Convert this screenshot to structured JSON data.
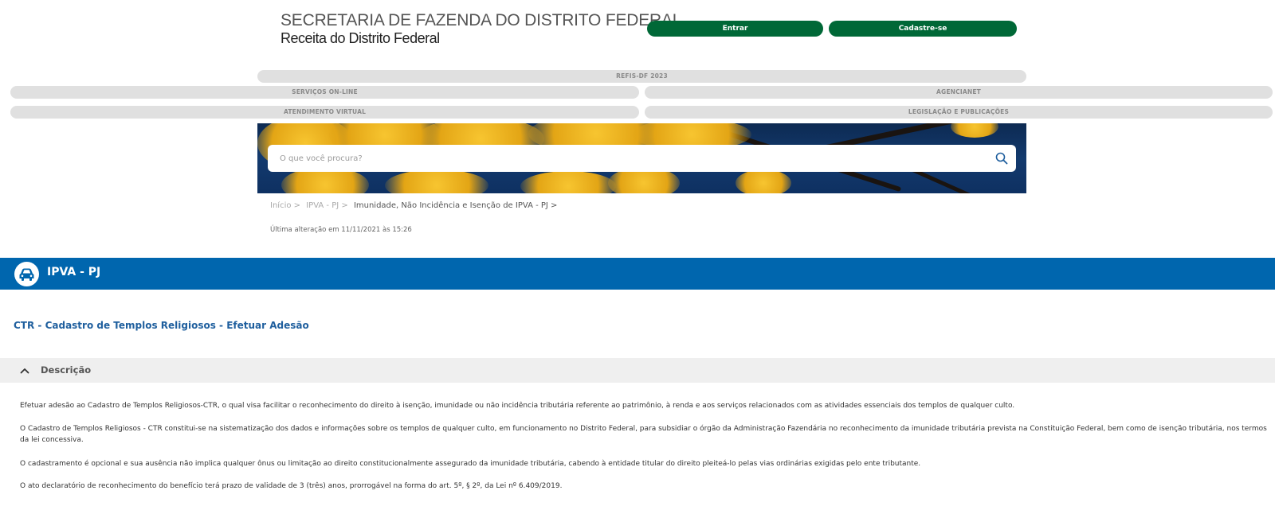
{
  "header": {
    "brand_line1": "SECRETARIA DE FAZENDA DO DISTRITO FEDERAL",
    "brand_line2": "Receita do Distrito Federal",
    "login_label": "Entrar",
    "register_label": "Cadastre-se"
  },
  "nav": {
    "refis": "REFIS-DF 2023",
    "servicos": "SERVIÇOS ON-LINE",
    "agencianet": "AGENCIANET",
    "atendimento": "ATENDIMENTO VIRTUAL",
    "legislacao": "LEGISLAÇÃO E PUBLICAÇÕES"
  },
  "search": {
    "placeholder": "O que você procura?"
  },
  "breadcrumb": {
    "items": [
      "Início >",
      "IPVA - PJ >",
      "Imunidade, Não Incidência e Isenção de IPVA - PJ >"
    ]
  },
  "last_updated": "Última alteração em 11/11/2021 às 15:26",
  "section": {
    "title": "IPVA - PJ"
  },
  "service": {
    "title": "CTR - Cadastro de Templos Religiosos - Efetuar Adesão"
  },
  "description": {
    "heading": "Descrição",
    "paragraphs": [
      "Efetuar adesão ao Cadastro de Templos Religiosos-CTR, o qual visa facilitar o reconhecimento do direito à isenção, imunidade ou não incidência tributária referente ao patrimônio, à renda e aos serviços relacionados com as atividades essenciais dos templos de qualquer culto.",
      "O Cadastro de Templos Religiosos - CTR constitui-se na sistematização dos dados e informações sobre os templos de qualquer culto, em funcionamento no Distrito Federal, para subsidiar o órgão da Administração Fazendária no reconhecimento da imunidade tributária prevista na Constituição Federal, bem como de isenção tributária, nos termos da lei concessiva.",
      "O cadastramento é opcional e sua ausência não implica qualquer ônus ou limitação ao direito constitucionalmente assegurado da imunidade tributária, cabendo à entidade titular do direito pleiteá-lo pelas vias ordinárias exigidas pelo ente tributante.",
      "O ato declaratório de reconhecimento do benefício terá prazo de validade de 3 (três) anos, prorrogável na forma do art. 5º, § 2º, da Lei nº 6.409/2019."
    ]
  },
  "colors": {
    "green": "#006837",
    "blue": "#0066ae",
    "link": "#1f5f9e",
    "pill": "#e0e0e0"
  },
  "icons": [
    "search-icon",
    "car-icon",
    "chevron-up-icon"
  ]
}
